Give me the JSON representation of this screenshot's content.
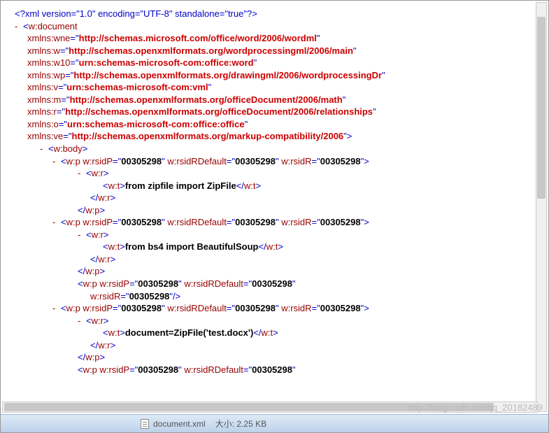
{
  "xmlDecl": {
    "version": "1.0",
    "encoding": "UTF-8",
    "standalone": "true"
  },
  "root": "w:document",
  "ns": {
    "wne": {
      "attr": "xmlns:wne",
      "val": "http://schemas.microsoft.com/office/word/2006/wordml"
    },
    "w": {
      "attr": "xmlns:w",
      "val": "http://schemas.openxmlformats.org/wordprocessingml/2006/main"
    },
    "w10": {
      "attr": "xmlns:w10",
      "val": "urn:schemas-microsoft-com:office:word"
    },
    "wp": {
      "attr": "xmlns:wp",
      "val": "http://schemas.openxmlformats.org/drawingml/2006/wordprocessingDr"
    },
    "v": {
      "attr": "xmlns:v",
      "val": "urn:schemas-microsoft-com:vml"
    },
    "m": {
      "attr": "xmlns:m",
      "val": "http://schemas.openxmlformats.org/officeDocument/2006/math"
    },
    "r": {
      "attr": "xmlns:r",
      "val": "http://schemas.openxmlformats.org/officeDocument/2006/relationships"
    },
    "o": {
      "attr": "xmlns:o",
      "val": "urn:schemas-microsoft-com:office:office"
    },
    "ve": {
      "attr": "xmlns:ve",
      "val": "http://schemas.openxmlformats.org/markup-compatibility/2006"
    }
  },
  "rsid": "00305298",
  "paras": [
    {
      "text": "from zipfile import ZipFile"
    },
    {
      "text": "from bs4 import BeautifulSoup"
    },
    {
      "empty": true
    },
    {
      "text": "document=ZipFile('test.docx')"
    }
  ],
  "tags": {
    "body": "w:body",
    "p": "w:p",
    "r": "w:r",
    "t": "w:t",
    "rsidP": "w:rsidP",
    "rsidRDefault": "w:rsidRDefault",
    "rsidR": "w:rsidR"
  },
  "taskbar": {
    "filename": "document.xml",
    "sizeLabel": "大小:",
    "size": "2.25 KB"
  },
  "watermark": "http://blog.csdn.net/qq_20182489"
}
